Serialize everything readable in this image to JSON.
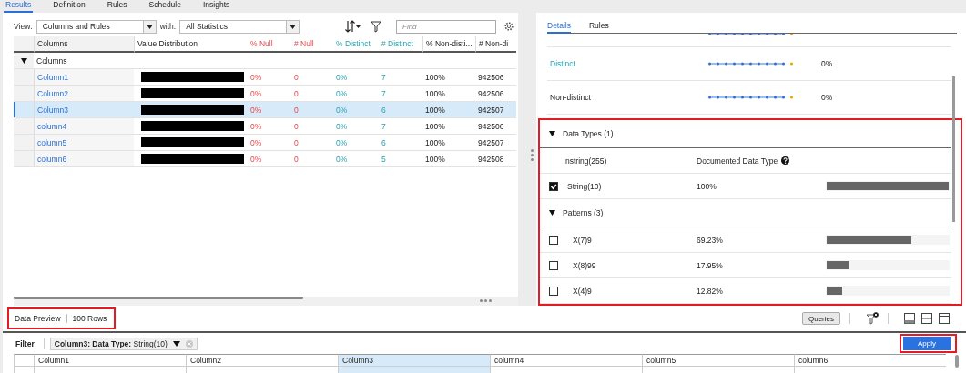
{
  "tabs": [
    {
      "label": "Results",
      "selected": true
    },
    {
      "label": "Definition",
      "selected": false
    },
    {
      "label": "Rules",
      "selected": false
    },
    {
      "label": "Schedule",
      "selected": false
    },
    {
      "label": "Insights",
      "selected": false
    }
  ],
  "results": {
    "view_label": "View:",
    "view_value": "Columns and Rules",
    "with_label": "with:",
    "with_value": "All Statistics",
    "find_placeholder": "Find",
    "name_header": "Columns",
    "distribution_header": "Value Distribution",
    "stat_columns": [
      {
        "label": "% Null",
        "kind": "null"
      },
      {
        "label": "# Null",
        "kind": "null"
      },
      {
        "label": "% Distinct",
        "kind": "distinct"
      },
      {
        "label": "# Distinct",
        "kind": "distinct"
      },
      {
        "label": "% Non-disti...",
        "kind": "plain"
      },
      {
        "label": "# Non-di",
        "kind": "plain"
      }
    ],
    "group": {
      "label": "Columns",
      "expanded": true
    },
    "rows": [
      {
        "name": "Column1",
        "selected": false,
        "cells": [
          "0%",
          "0",
          "0%",
          "7",
          "100%",
          "942506"
        ]
      },
      {
        "name": "Column2",
        "selected": false,
        "cells": [
          "0%",
          "0",
          "0%",
          "7",
          "100%",
          "942506"
        ]
      },
      {
        "name": "Column3",
        "selected": true,
        "cells": [
          "0%",
          "0",
          "0%",
          "6",
          "100%",
          "942507"
        ]
      },
      {
        "name": "column4",
        "selected": false,
        "cells": [
          "0%",
          "0",
          "0%",
          "7",
          "100%",
          "942506"
        ]
      },
      {
        "name": "column5",
        "selected": false,
        "cells": [
          "0%",
          "0",
          "0%",
          "6",
          "100%",
          "942507"
        ]
      },
      {
        "name": "column6",
        "selected": false,
        "cells": [
          "0%",
          "0",
          "0%",
          "5",
          "100%",
          "942508"
        ]
      }
    ]
  },
  "details": {
    "tabs": [
      {
        "label": "Details",
        "selected": true
      },
      {
        "label": "Rules",
        "selected": false
      }
    ],
    "stats": [
      {
        "label": "Distinct",
        "kind": "distinct",
        "value": "0%"
      },
      {
        "label": "Non-distinct",
        "kind": "plain",
        "value": "0%"
      }
    ],
    "highlighted": true,
    "data_types": {
      "title": "Data Types (1)",
      "expanded": true,
      "header": [
        "nstring(255)",
        "Documented Data Type"
      ],
      "rows": [
        {
          "label": "String(10)",
          "checked": true,
          "percent": "100%",
          "level": 1
        }
      ]
    },
    "patterns": {
      "title": "Patterns (3)",
      "expanded": true,
      "rows": [
        {
          "label": "X(7)9",
          "checked": false,
          "percent": "69.23%",
          "level": 0.6923
        },
        {
          "label": "X(8)99",
          "checked": false,
          "percent": "17.95%",
          "level": 0.1795
        },
        {
          "label": "X(4)9",
          "checked": false,
          "percent": "12.82%",
          "level": 0.1282
        }
      ]
    }
  },
  "preview": {
    "title": "Data Preview",
    "row_count": "100 Rows",
    "highlighted": true,
    "queries": "Queries",
    "filter_label": "Filter",
    "filter_chip": "**Column3: Data Type:** String(10)",
    "apply": "Apply",
    "apply_highlighted": true,
    "columns": [
      {
        "label": "Column1",
        "selected": false
      },
      {
        "label": "Column2",
        "selected": false
      },
      {
        "label": "Column3",
        "selected": true
      },
      {
        "label": "column4",
        "selected": false
      },
      {
        "label": "column5",
        "selected": false
      },
      {
        "label": "column6",
        "selected": false
      }
    ]
  }
}
